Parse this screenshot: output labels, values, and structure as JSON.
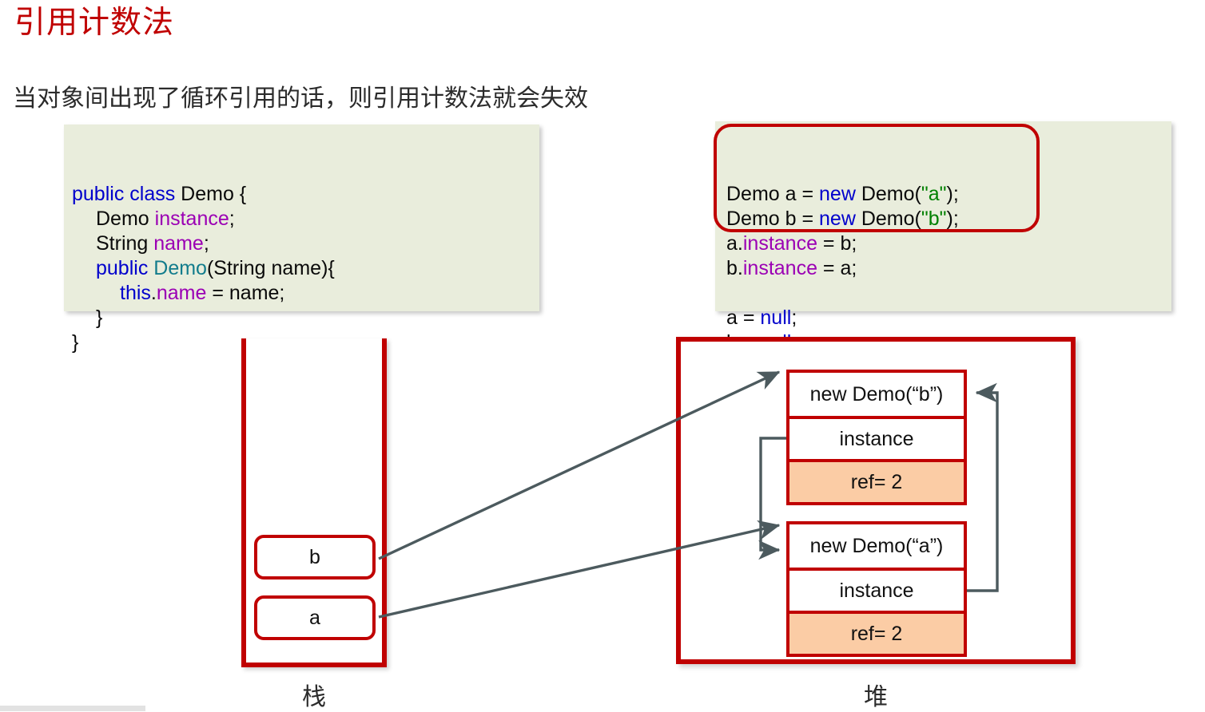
{
  "slide": {
    "title": "引用计数法",
    "subtitle": "当对象间出现了循环引用的话，则引用计数法就会失效"
  },
  "colors": {
    "title_red": "#C00000",
    "border_red": "#C00000",
    "code_background": "#E9EDDC",
    "ref_cell_orange": "#FBCCA5",
    "arrow_gray": "#4C5A5E",
    "keyword_blue": "#0000CC",
    "field_purple": "#9B00B4",
    "type_teal": "#127C8C",
    "string_green": "#008000"
  },
  "code_class": {
    "lines": [
      {
        "indent": 0,
        "tokens": [
          {
            "t": "public class ",
            "c": "kw"
          },
          {
            "t": "Demo {",
            "c": "pun"
          }
        ]
      },
      {
        "indent": 1,
        "tokens": [
          {
            "t": "Demo ",
            "c": "pun"
          },
          {
            "t": "instance",
            "c": "fld"
          },
          {
            "t": ";",
            "c": "pun"
          }
        ]
      },
      {
        "indent": 1,
        "tokens": [
          {
            "t": "String ",
            "c": "pun"
          },
          {
            "t": "name",
            "c": "fld"
          },
          {
            "t": ";",
            "c": "pun"
          }
        ]
      },
      {
        "indent": 1,
        "tokens": [
          {
            "t": "public ",
            "c": "kw"
          },
          {
            "t": "Demo",
            "c": "typ"
          },
          {
            "t": "(String name){",
            "c": "pun"
          }
        ]
      },
      {
        "indent": 2,
        "tokens": [
          {
            "t": "this",
            "c": "kw"
          },
          {
            "t": ".",
            "c": "pun"
          },
          {
            "t": "name",
            "c": "fld"
          },
          {
            "t": " = name;",
            "c": "pun"
          }
        ]
      },
      {
        "indent": 1,
        "tokens": [
          {
            "t": "}",
            "c": "pun"
          }
        ]
      },
      {
        "indent": 0,
        "tokens": [
          {
            "t": "}",
            "c": "pun"
          }
        ]
      }
    ]
  },
  "code_main": {
    "lines": [
      {
        "indent": 0,
        "tokens": [
          {
            "t": "Demo a = ",
            "c": "pun"
          },
          {
            "t": "new ",
            "c": "kw"
          },
          {
            "t": "Demo(",
            "c": "pun"
          },
          {
            "t": "\"a\"",
            "c": "str"
          },
          {
            "t": ");",
            "c": "pun"
          }
        ]
      },
      {
        "indent": 0,
        "tokens": [
          {
            "t": "Demo b = ",
            "c": "pun"
          },
          {
            "t": "new ",
            "c": "kw"
          },
          {
            "t": "Demo(",
            "c": "pun"
          },
          {
            "t": "\"b\"",
            "c": "str"
          },
          {
            "t": ");",
            "c": "pun"
          }
        ]
      },
      {
        "indent": 0,
        "tokens": [
          {
            "t": "a.",
            "c": "pun"
          },
          {
            "t": "instance",
            "c": "fld"
          },
          {
            "t": " = b;",
            "c": "pun"
          }
        ]
      },
      {
        "indent": 0,
        "tokens": [
          {
            "t": "b.",
            "c": "pun"
          },
          {
            "t": "instance",
            "c": "fld"
          },
          {
            "t": " = a;",
            "c": "pun"
          }
        ]
      },
      {
        "indent": 0,
        "tokens": [
          {
            "t": " ",
            "c": "pun"
          }
        ]
      },
      {
        "indent": 0,
        "tokens": [
          {
            "t": "a = ",
            "c": "pun"
          },
          {
            "t": "null",
            "c": "kw"
          },
          {
            "t": ";",
            "c": "pun"
          }
        ]
      },
      {
        "indent": 0,
        "tokens": [
          {
            "t": "b = ",
            "c": "pun"
          },
          {
            "t": "null",
            "c": "kw"
          },
          {
            "t": ";",
            "c": "pun"
          }
        ]
      }
    ]
  },
  "diagram": {
    "stack": {
      "label": "栈",
      "slots": [
        {
          "name": "b"
        },
        {
          "name": "a"
        }
      ]
    },
    "heap": {
      "label": "堆",
      "objects": [
        {
          "title": "new Demo(“b”)",
          "field": "instance",
          "ref": "ref= 2"
        },
        {
          "title": "new Demo(“a”)",
          "field": "instance",
          "ref": "ref= 2"
        }
      ]
    }
  }
}
